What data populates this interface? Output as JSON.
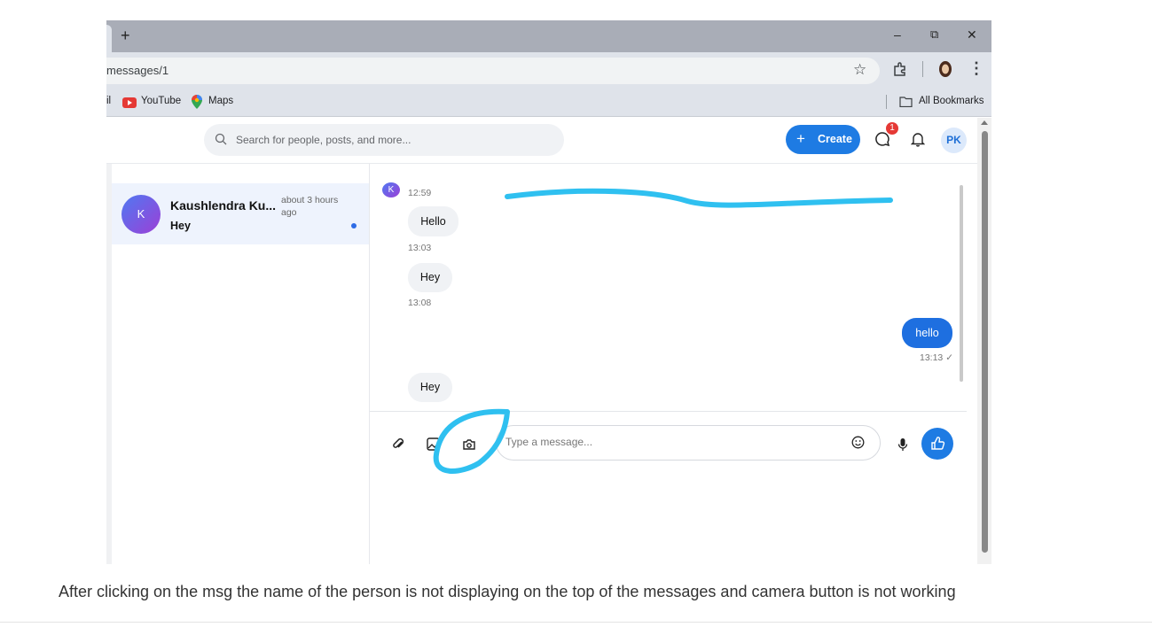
{
  "browser": {
    "new_tab_label": "+",
    "minimize_glyph": "–",
    "restore_glyph": "⧉",
    "close_glyph": "✕",
    "url": "messages/1",
    "star_glyph": "☆",
    "menu_glyph": "⋮",
    "bookmarks": [
      {
        "label": "il"
      },
      {
        "label": "YouTube"
      },
      {
        "label": "Maps"
      },
      {
        "label": "All Bookmarks"
      }
    ]
  },
  "header": {
    "search_placeholder": "Search for people, posts, and more...",
    "create_label": "Create",
    "create_icon": "+",
    "notification_badge": "1",
    "avatar_initials": "PK"
  },
  "conversations": [
    {
      "avatar_initial": "K",
      "name": "Kaushlendra Ku...",
      "time": "about 3 hours ago",
      "preview": "Hey",
      "unread": true
    }
  ],
  "messages": [
    {
      "avatar_initial": "K",
      "time": "12:59"
    },
    {
      "text": "Hello",
      "time": "13:03",
      "side": "left"
    },
    {
      "text": "Hey",
      "time": "13:08",
      "side": "left"
    },
    {
      "text": "hello",
      "time": "13:13 ✓",
      "side": "right"
    },
    {
      "text": "Hey",
      "side": "left"
    }
  ],
  "composer": {
    "placeholder": "Type a message..."
  },
  "caption": "After clicking on the msg the name of the person is not displaying on the top of the messages and camera button is not working",
  "colors": {
    "accent": "#1e7be3",
    "annotation": "#2fc0f0",
    "badge": "#e53935"
  }
}
